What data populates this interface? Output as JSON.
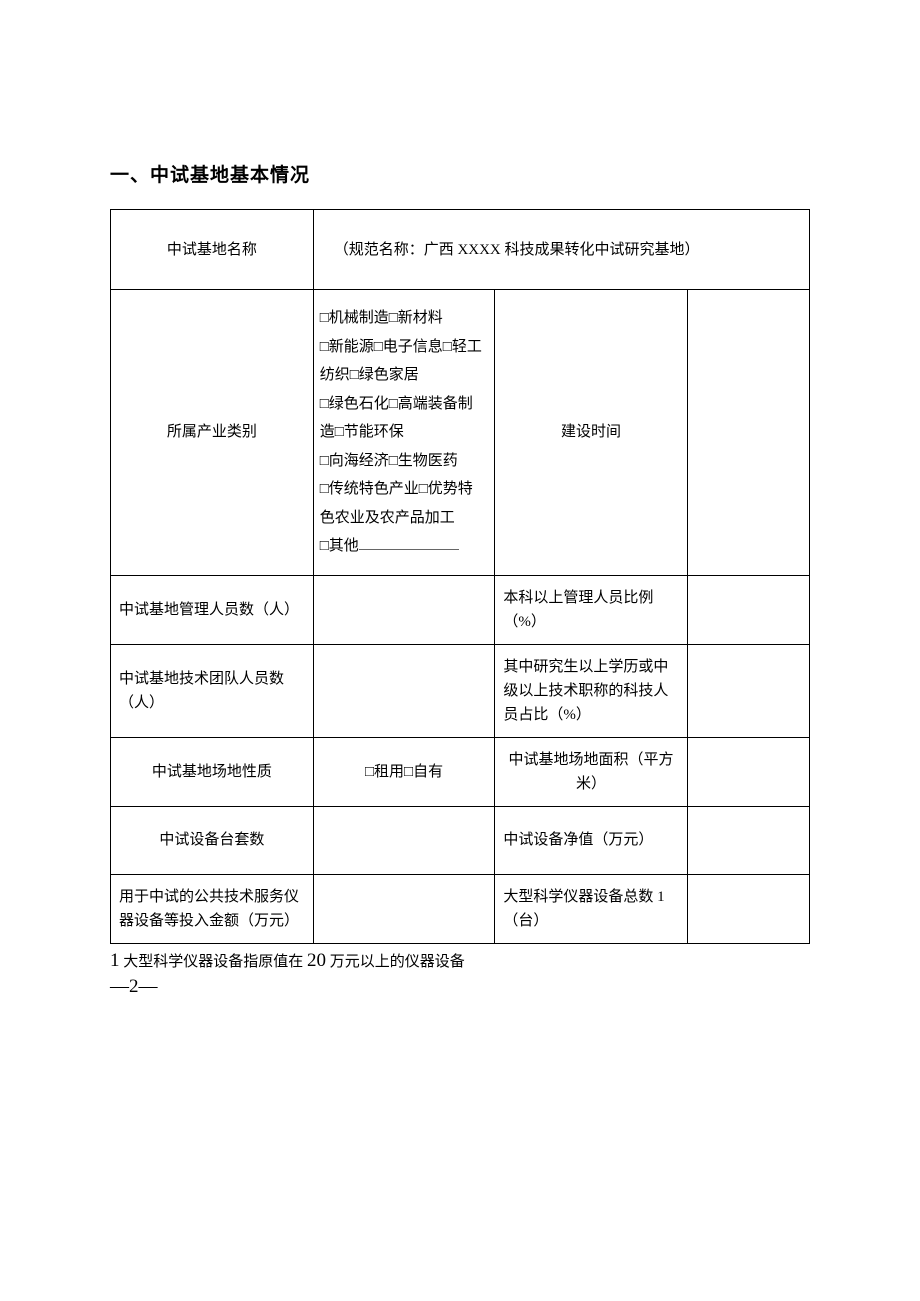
{
  "heading": "一、中试基地基本情况",
  "rows": {
    "r1_label": "中试基地名称",
    "r1_value": "（规范名称：广西 XXXX 科技成果转化中试研究基地）",
    "r2_label": "所属产业类别",
    "r2_options_l1": "□机械制造□新材料",
    "r2_options_l2": "□新能源□电子信息□轻工纺织□绿色家居",
    "r2_options_l3": "□绿色石化□高端装备制造□节能环保",
    "r2_options_l4": "□向海经济□生物医药",
    "r2_options_l5": "□传统特色产业□优势特色农业及农产品加工",
    "r2_options_l6": "□其他",
    "r2_right_label": "建设时间",
    "r2_right_value": "",
    "r3_label": "中试基地管理人员数（人）",
    "r3_value": "",
    "r3_right_label": "本科以上管理人员比例（%）",
    "r3_right_value": "",
    "r4_label": "中试基地技术团队人员数（人）",
    "r4_value": "",
    "r4_right_label": "其中研究生以上学历或中级以上技术职称的科技人员占比（%）",
    "r4_right_value": "",
    "r5_label": "中试基地场地性质",
    "r5_value": "□租用□自有",
    "r5_right_label": "中试基地场地面积（平方米）",
    "r5_right_value": "",
    "r6_label": "中试设备台套数",
    "r6_value": "",
    "r6_right_label": "中试设备净值（万元）",
    "r6_right_value": "",
    "r7_label": "用于中试的公共技术服务仪器设备等投入金额（万元）",
    "r7_value": "",
    "r7_right_label": "大型科学仪器设备总数 1（台）",
    "r7_right_value": ""
  },
  "footnote": {
    "num": "1",
    "text_before": " 大型科学仪器设备指原值在 ",
    "twenty": "20",
    "text_after": " 万元以上的仪器设备"
  },
  "pagenum": "—2—"
}
